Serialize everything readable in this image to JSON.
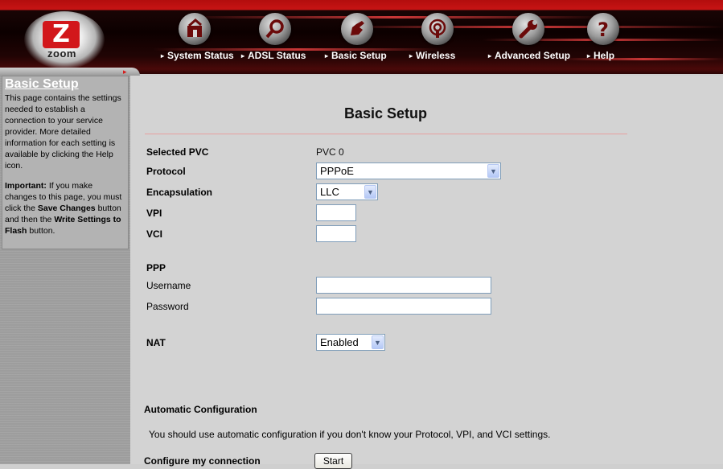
{
  "header": {
    "logo": {
      "letter": "Z",
      "text": "zoom"
    },
    "nav": [
      {
        "label": "System Status",
        "icon": "system-status-icon"
      },
      {
        "label": "ADSL Status",
        "icon": "magnifier-icon"
      },
      {
        "label": "Basic Setup",
        "icon": "hand-icon"
      },
      {
        "label": "Wireless",
        "icon": "wireless-icon"
      },
      {
        "label": "Advanced Setup",
        "icon": "wrench-icon"
      },
      {
        "label": "Help",
        "icon": "help-icon"
      }
    ],
    "arrow_glyph": "▸"
  },
  "sidebar": {
    "title": "Basic Setup",
    "description": "This page contains the settings needed to establish a connection to your service provider. More detailed information for each setting is available by clicking the Help icon.",
    "important_label": "Important:",
    "important_text_1": " If you make changes to this page, you must click the ",
    "save_changes": "Save Changes",
    "important_text_2": " button and then the ",
    "write_settings": "Write Settings to Flash",
    "important_text_3": " button."
  },
  "main": {
    "title": "Basic Setup",
    "selected_pvc_label": "Selected PVC",
    "selected_pvc_value": "PVC 0",
    "protocol_label": "Protocol",
    "protocol_value": "PPPoE",
    "encapsulation_label": "Encapsulation",
    "encapsulation_value": "LLC",
    "vpi_label": "VPI",
    "vpi_value": "",
    "vci_label": "VCI",
    "vci_value": "",
    "ppp_heading": "PPP",
    "username_label": "Username",
    "username_value": "",
    "password_label": "Password",
    "password_value": "",
    "nat_label": "NAT",
    "nat_value": "Enabled",
    "auto_config_heading": "Automatic Configuration",
    "auto_config_text": "You should use automatic configuration if you don't know your Protocol, VPI, and VCI settings.",
    "configure_label": "Configure my connection",
    "start_button": "Start",
    "dropdown_glyph": "▼"
  },
  "colors": {
    "header_red": "#c71414",
    "brand_red": "#d2171b",
    "content_bg": "#d3d3d3",
    "sidebar_bg": "#9d9d9d",
    "divider": "#a31313"
  }
}
